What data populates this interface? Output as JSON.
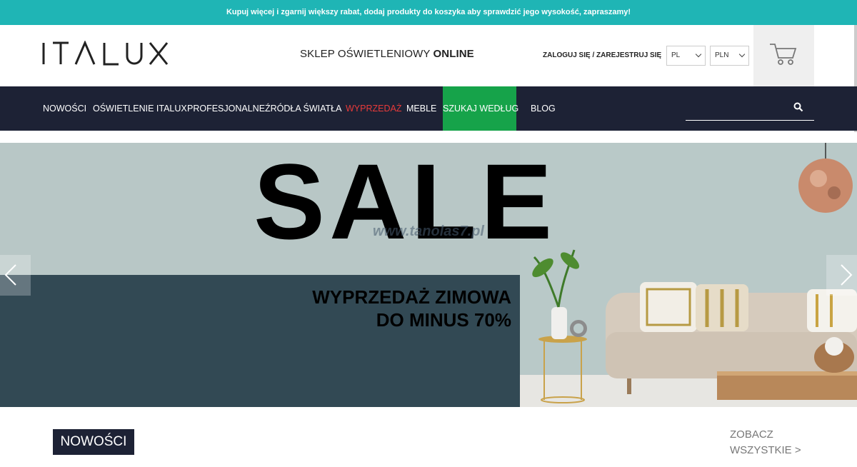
{
  "promo_bar": {
    "text": "Kupuj więcej i zgarnij większy rabat, dodaj produkty do koszyka aby sprawdzić jego wysokość, zapraszamy!"
  },
  "header": {
    "logo_text": "ITALUX",
    "tagline_regular": "SKLEP OŚWIETLENIOWY ",
    "tagline_bold": "ONLINE",
    "login": "ZALOGUJ SIĘ",
    "separator": " / ",
    "register": "ZAREJESTRUJ SIĘ",
    "language": "PL",
    "currency": "PLN",
    "cart_icon": "cart-icon"
  },
  "nav": {
    "items": [
      {
        "label": "NOWOŚCI"
      },
      {
        "label": "OŚWIETLENIE ITALUX"
      },
      {
        "label": "PROFESJONALNE"
      },
      {
        "label": "ŹRÓDŁA ŚWIATŁA"
      },
      {
        "label": "WYPRZEDAŻ"
      },
      {
        "label": "MEBLE"
      },
      {
        "label": "SZUKAJ WEDŁUG"
      },
      {
        "label": "BLOG"
      }
    ],
    "search_icon": "search-icon",
    "sale_color": "#e83a3a",
    "highlight_color": "#16a34a"
  },
  "hero": {
    "headline": "SALE",
    "subline_1": "WYPRZEDAŻ ZIMOWA",
    "subline_2": "DO MINUS 70%",
    "watermark": "www.tanolas7.pl"
  },
  "section": {
    "title": "NOWOŚCI",
    "see_all_1": "ZOBACZ",
    "see_all_2": "WSZYSTKIE >"
  },
  "colors": {
    "teal": "#1fb5b5",
    "navy": "#1d2235",
    "hero_bg": "#b8c7c6",
    "hero_dark": "#324954"
  }
}
